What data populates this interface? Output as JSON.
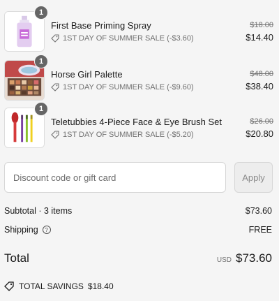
{
  "items": [
    {
      "name": "First Base Priming Spray",
      "quantity": "1",
      "discount": "1ST DAY OF SUMMER SALE (-$3.60)",
      "original_price": "$18.00",
      "price": "$14.40",
      "image_icon": "spray-bottle-icon"
    },
    {
      "name": "Horse Girl Palette",
      "quantity": "1",
      "discount": "1ST DAY OF SUMMER SALE (-$9.60)",
      "original_price": "$48.00",
      "price": "$38.40",
      "image_icon": "eyeshadow-palette-icon"
    },
    {
      "name": "Teletubbies 4-Piece Face & Eye Brush Set",
      "quantity": "1",
      "discount": "1ST DAY OF SUMMER SALE (-$5.20)",
      "original_price": "$26.00",
      "price": "$20.80",
      "image_icon": "brush-set-icon"
    }
  ],
  "discount_code": {
    "placeholder": "Discount code or gift card",
    "value": "",
    "apply_label": "Apply"
  },
  "summary": {
    "subtotal_label": "Subtotal · 3 items",
    "subtotal_value": "$73.60",
    "shipping_label": "Shipping",
    "shipping_value": "FREE",
    "total_label": "Total",
    "currency": "USD",
    "total_value": "$73.60",
    "savings_label": "TOTAL SAVINGS",
    "savings_value": "$18.40"
  },
  "colors": {
    "background": "#f5f5f5",
    "badge": "#666666",
    "muted_text": "#707070"
  }
}
